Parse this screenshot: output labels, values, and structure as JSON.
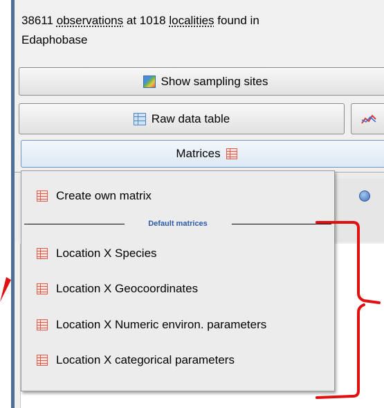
{
  "info": {
    "count": "38611",
    "observations": "observations",
    "at": "at",
    "localities_count": "1018",
    "localities": "localities",
    "found_in": "found in",
    "source": "Edaphobase"
  },
  "buttons": {
    "show_sampling_sites": "Show sampling sites",
    "raw_data_table": "Raw data table",
    "matrices": "Matrices"
  },
  "dropdown": {
    "create_own_matrix": "Create own matrix",
    "section_title": "Default matrices",
    "items": [
      "Location X Species",
      "Location X Geocoordinates",
      "Location X Numeric environ. parameters",
      "Location X categorical parameters"
    ]
  },
  "colors": {
    "accent_blue": "#2d5aa8",
    "annotation_red": "#e01010",
    "panel_border": "#4f6f94",
    "matrix_icon": "#e2584a"
  },
  "icons": {
    "sampling_sites": "map-icon",
    "raw_data": "table-icon",
    "chart": "chart-icon",
    "matrix": "matrix-icon",
    "help": "help-icon"
  }
}
